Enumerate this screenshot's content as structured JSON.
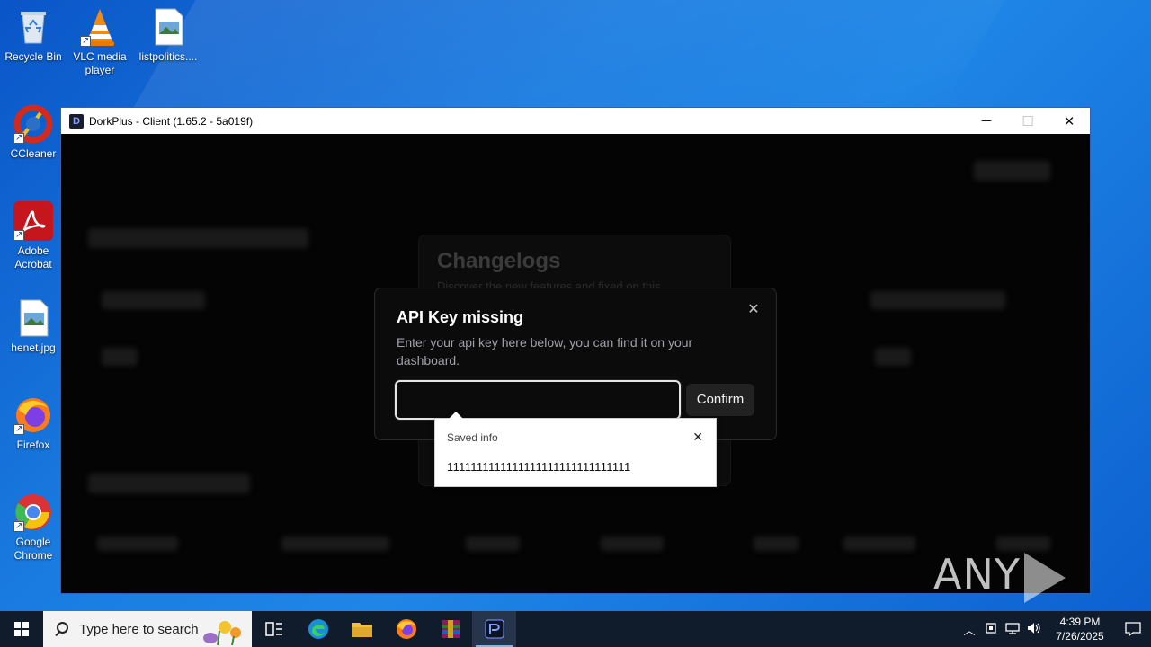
{
  "desktop": {
    "icons": [
      {
        "label": "Recycle Bin",
        "icon": "recycle-bin-icon"
      },
      {
        "label": "VLC media player",
        "icon": "vlc-icon"
      },
      {
        "label": "listpolitics....",
        "icon": "image-file-icon"
      },
      {
        "label": "CCleaner",
        "icon": "ccleaner-icon"
      },
      {
        "label": "Adobe Acrobat",
        "icon": "adobe-acrobat-icon"
      },
      {
        "label": "henet.jpg",
        "icon": "image-file-icon"
      },
      {
        "label": "Firefox",
        "icon": "firefox-icon"
      },
      {
        "label": "Google Chrome",
        "icon": "chrome-icon"
      }
    ]
  },
  "window": {
    "title": "DorkPlus - Client (1.65.2 - 5a019f)",
    "controls": {
      "minimize": "─",
      "maximize": "☐",
      "close": "✕"
    }
  },
  "background_page": {
    "changelog_title": "Changelogs",
    "changelog_subtitle": "Discover the new features and fixed on this"
  },
  "modal": {
    "title": "API Key missing",
    "description": "Enter your api key here below, you can find it on your dashboard.",
    "input_value": "",
    "confirm_label": "Confirm",
    "close_glyph": "✕"
  },
  "autofill": {
    "header": "Saved info",
    "value": "1111111111111111111111111111111",
    "close_glyph": "✕"
  },
  "watermark": {
    "left": "ANY",
    "right": "RUN"
  },
  "taskbar": {
    "search_placeholder": "Type here to search",
    "apps": [
      "task-view-icon",
      "edge-icon",
      "file-explorer-icon",
      "firefox-icon",
      "winrar-icon",
      "dorkplus-icon"
    ],
    "active_app": "dorkplus-icon",
    "tray": {
      "time": "4:39 PM",
      "date": "7/26/2025"
    }
  },
  "colors": {
    "desktop_blue": "#1a7ce0",
    "app_background": "#040404",
    "modal_background": "#0b0b0b",
    "taskbar": "#101c2c"
  }
}
